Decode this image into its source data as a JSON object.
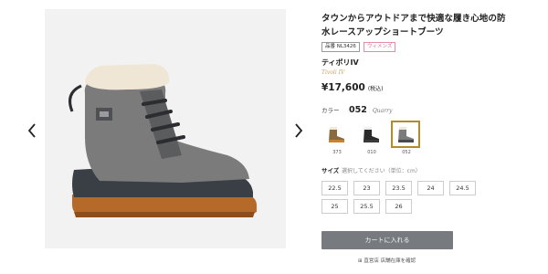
{
  "product": {
    "title": "タウンからアウトドアまで快適な履き心地の防水レースアップショートブーツ",
    "tags": [
      "品番 NL3426",
      "ウィメンズ"
    ],
    "series": "ティボリIV",
    "brand_sub": "Tivoli IV",
    "price": "¥17,600",
    "tax": "(税込)"
  },
  "color": {
    "label": "カラー",
    "selected_code": "052",
    "selected_name": "Quarry",
    "swatches": [
      {
        "code": "373",
        "icon": "boot-tan-thumbnail"
      },
      {
        "code": "010",
        "icon": "boot-black-thumbnail"
      },
      {
        "code": "052",
        "icon": "boot-grey-thumbnail",
        "selected": true
      }
    ]
  },
  "size": {
    "label": "サイズ",
    "hint": "選択してください（単位：cm）",
    "options": [
      "22.5",
      "23",
      "23.5",
      "24",
      "24.5",
      "25",
      "25.5",
      "26"
    ]
  },
  "cart_button": "カートに入れる",
  "store_link": "⊞ 直営店 店舗在庫を確認",
  "colors": {
    "selected_border": "#b38b2d",
    "cart_bg": "#777a7e",
    "pink_tag": "#e06a8f",
    "brand_sub": "#c9a26a"
  }
}
